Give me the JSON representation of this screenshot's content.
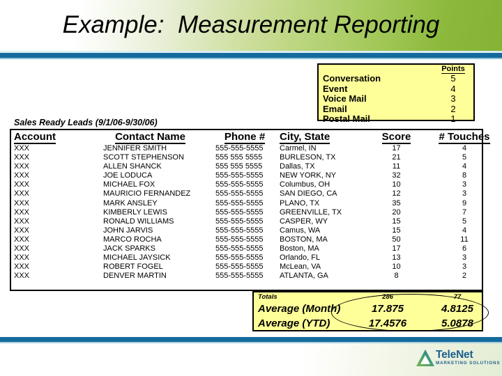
{
  "slide": {
    "title": "Example:  Measurement Reporting",
    "accent_green": "#85b334",
    "accent_blue": "#146a9c",
    "highlight_yellow": "#ffff99"
  },
  "points_legend": {
    "points_header": "Points",
    "rows": [
      {
        "activity": "Conversation",
        "points": "5"
      },
      {
        "activity": "Event",
        "points": "4"
      },
      {
        "activity": "Voice Mail",
        "points": "3"
      },
      {
        "activity": "Email",
        "points": "2"
      },
      {
        "activity": "Postal Mail",
        "points": "1"
      }
    ]
  },
  "leads_report": {
    "caption": "Sales Ready Leads (9/1/06-9/30/06)",
    "headers": {
      "account": "Account",
      "contact": "Contact Name",
      "phone": "Phone #",
      "city_state": "City, State",
      "score": "Score",
      "touches": "# Touches"
    },
    "rows": [
      {
        "account": "XXX",
        "contact": "JENNIFER SMITH",
        "phone": "555-555-5555",
        "city_state": "Carmel, IN",
        "score": "17",
        "touches": "4"
      },
      {
        "account": "XXX",
        "contact": "SCOTT STEPHENSON",
        "phone": "555 555 5555",
        "city_state": "BURLESON, TX",
        "score": "21",
        "touches": "5"
      },
      {
        "account": "XXX",
        "contact": "ALLEN SHANCK",
        "phone": "555 555 5555",
        "city_state": "Dallas, TX",
        "score": "11",
        "touches": "4"
      },
      {
        "account": "XXX",
        "contact": "JOE LODUCA",
        "phone": "555-555-5555",
        "city_state": "NEW YORK, NY",
        "score": "32",
        "touches": "8"
      },
      {
        "account": "XXX",
        "contact": "MICHAEL FOX",
        "phone": "555-555-5555",
        "city_state": "Columbus, OH",
        "score": "10",
        "touches": "3"
      },
      {
        "account": "XXX",
        "contact": "MAURICIO FERNANDEZ",
        "phone": "555-555-5555",
        "city_state": "SAN DIEGO, CA",
        "score": "12",
        "touches": "3"
      },
      {
        "account": "XXX",
        "contact": "MARK ANSLEY",
        "phone": "555-555-5555",
        "city_state": "PLANO, TX",
        "score": "35",
        "touches": "9"
      },
      {
        "account": "XXX",
        "contact": "KIMBERLY LEWIS",
        "phone": "555-555-5555",
        "city_state": "GREENVILLE, TX",
        "score": "20",
        "touches": "7"
      },
      {
        "account": "XXX",
        "contact": "RONALD WILLIAMS",
        "phone": "555-555-5555",
        "city_state": "CASPER, WY",
        "score": "15",
        "touches": "5"
      },
      {
        "account": "XXX",
        "contact": "JOHN JARVIS",
        "phone": "555-555-5555",
        "city_state": "Camus, WA",
        "score": "15",
        "touches": "4"
      },
      {
        "account": "XXX",
        "contact": "MARCO ROCHA",
        "phone": "555-555-5555",
        "city_state": "BOSTON, MA",
        "score": "50",
        "touches": "11"
      },
      {
        "account": "XXX",
        "contact": "JACK SPARKS",
        "phone": "555-555-5555",
        "city_state": "Boston, MA",
        "score": "17",
        "touches": "6"
      },
      {
        "account": "XXX",
        "contact": "MICHAEL JAYSICK",
        "phone": "555-555-5555",
        "city_state": "Orlando, FL",
        "score": "13",
        "touches": "3"
      },
      {
        "account": "XXX",
        "contact": "ROBERT FOGEL",
        "phone": "555-555-5555",
        "city_state": "McLean, VA",
        "score": "10",
        "touches": "3"
      },
      {
        "account": "XXX",
        "contact": "DENVER MARTIN",
        "phone": "555-555-5555",
        "city_state": "ATLANTA, GA",
        "score": "8",
        "touches": "2"
      }
    ]
  },
  "summary": {
    "totals_label": "Totals",
    "totals_score": "286",
    "totals_touches": "77",
    "avg_month_label": "Average (Month)",
    "avg_month_score": "17.875",
    "avg_month_touches": "4.8125",
    "avg_ytd_label": "Average (YTD)",
    "avg_ytd_score": "17.4576",
    "avg_ytd_touches": "5.0878"
  },
  "logo": {
    "name": "TeleNet",
    "tagline": "MARKETING SOLUTIONS"
  }
}
